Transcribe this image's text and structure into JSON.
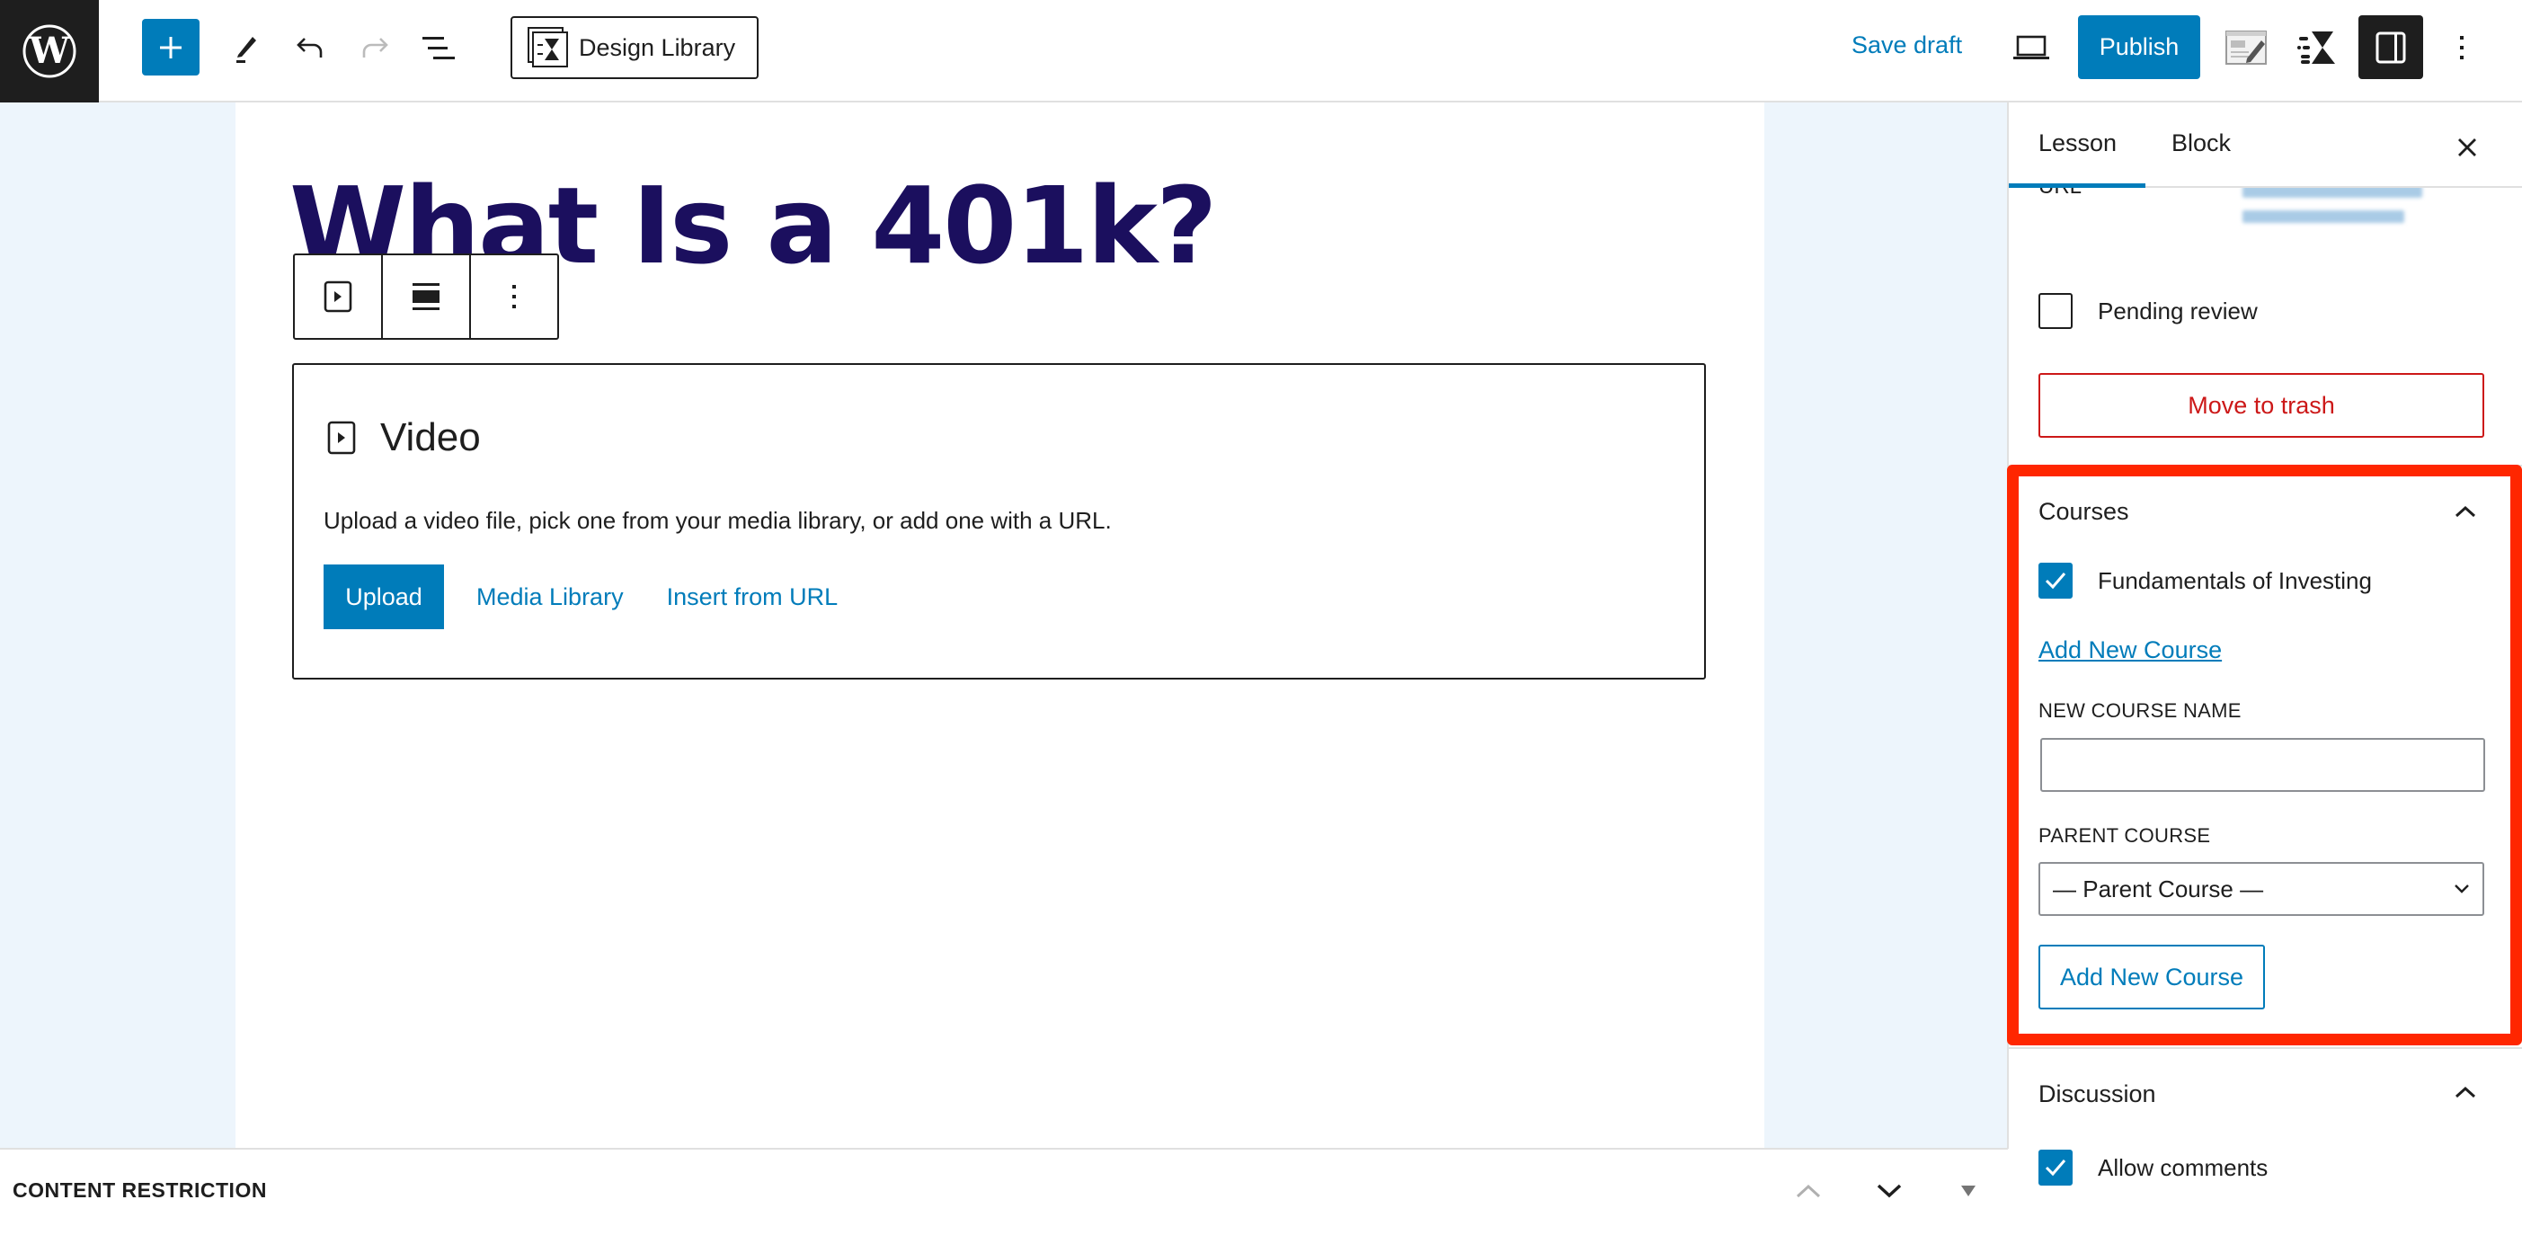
{
  "topbar": {
    "logo": "wordpress-logo",
    "add_block_icon": "plus-icon",
    "tools_icon": "pencil-icon",
    "undo_icon": "undo-icon",
    "redo_icon": "redo-icon",
    "list_view_icon": "list-view-icon",
    "design_library_label": "Design Library",
    "save_draft_label": "Save draft",
    "preview_icon": "laptop-icon",
    "publish_label": "Publish",
    "colors": {
      "accent": "#007cba",
      "dark": "#1e1e1e"
    }
  },
  "editor": {
    "heading": "What Is a 401k?",
    "heading_color": "#1b0f5e",
    "block_toolbar": {
      "block_type_icon": "video-icon",
      "align_icon": "align-center-icon",
      "options_icon": "more-vertical-icon"
    },
    "video_block": {
      "title": "Video",
      "instructions": "Upload a video file, pick one from your media library, or add one with a URL.",
      "upload_label": "Upload",
      "media_library_label": "Media Library",
      "insert_url_label": "Insert from URL"
    }
  },
  "bottombar": {
    "label": "CONTENT RESTRICTION"
  },
  "sidebar": {
    "tabs": [
      {
        "label": "Lesson",
        "active": true
      },
      {
        "label": "Block",
        "active": false
      }
    ],
    "url_label": "URL",
    "pending_review": {
      "label": "Pending review",
      "checked": false
    },
    "move_to_trash_label": "Move to trash",
    "courses_panel": {
      "title": "Courses",
      "courses": [
        {
          "label": "Fundamentals of Investing",
          "checked": true
        }
      ],
      "add_new_link": "Add New Course",
      "new_course_name_label": "NEW COURSE NAME",
      "new_course_name_value": "",
      "parent_course_label": "PARENT COURSE",
      "parent_course_selected": "— Parent Course —",
      "add_button_label": "Add New Course"
    },
    "discussion_panel": {
      "title": "Discussion",
      "allow_comments": {
        "label": "Allow comments",
        "checked": true
      }
    },
    "highlight_color": "#ff2600"
  }
}
